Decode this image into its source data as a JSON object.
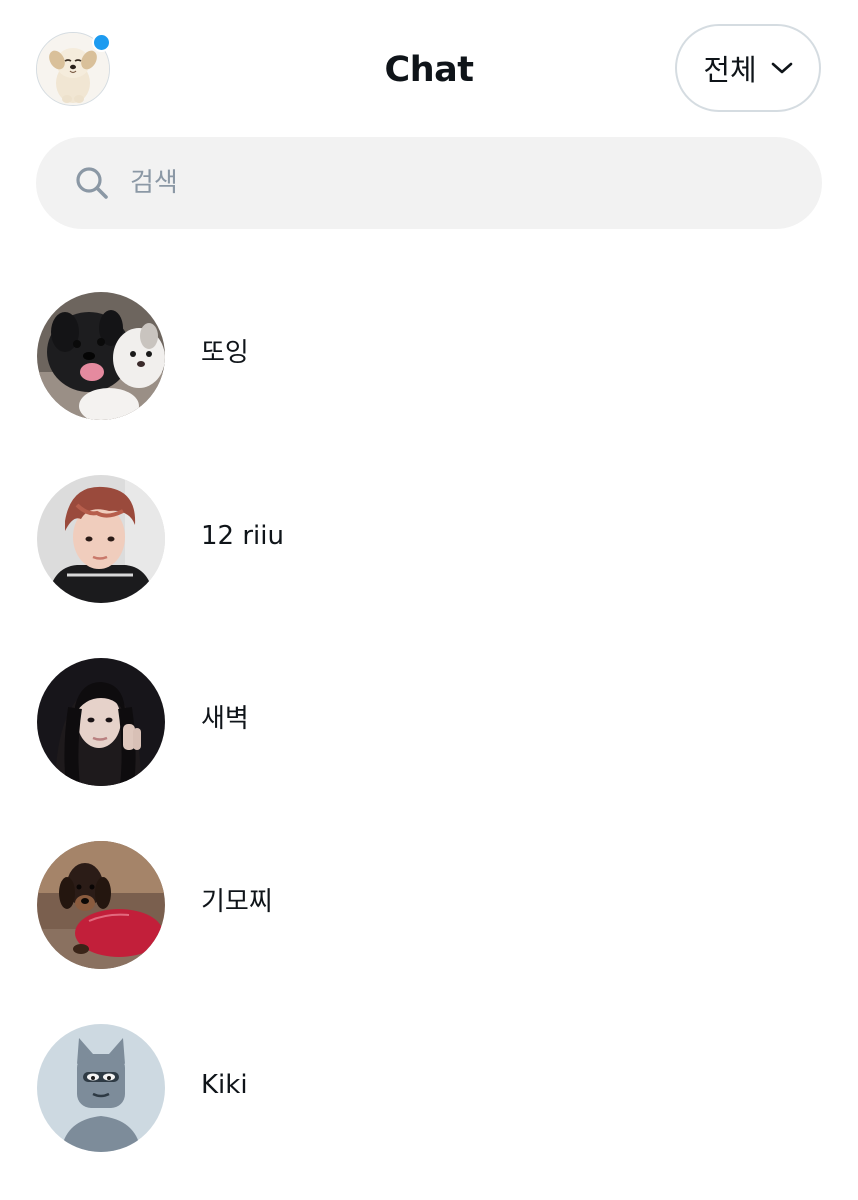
{
  "header": {
    "title": "Chat",
    "profile_avatar_icon": "puppy-avatar",
    "has_notification": true,
    "filter": {
      "label": "전체",
      "icon": "chevron-down-icon"
    }
  },
  "search": {
    "placeholder": "검색",
    "value": "",
    "icon": "search-icon"
  },
  "chats": [
    {
      "name": "또잉",
      "avatar": "two-puppies-photo"
    },
    {
      "name": "12 riiu",
      "avatar": "person-photo"
    },
    {
      "name": "새벽",
      "avatar": "person-selfie-photo"
    },
    {
      "name": "기모찌",
      "avatar": "dachshund-sweater-photo"
    },
    {
      "name": "Kiki",
      "avatar": "cat-illustration-avatar"
    }
  ],
  "colors": {
    "accent": "#1d9bf0",
    "text": "#0f1419",
    "search_bg": "#f2f2f2",
    "border": "#d5dce1",
    "placeholder": "#8b98a5"
  }
}
